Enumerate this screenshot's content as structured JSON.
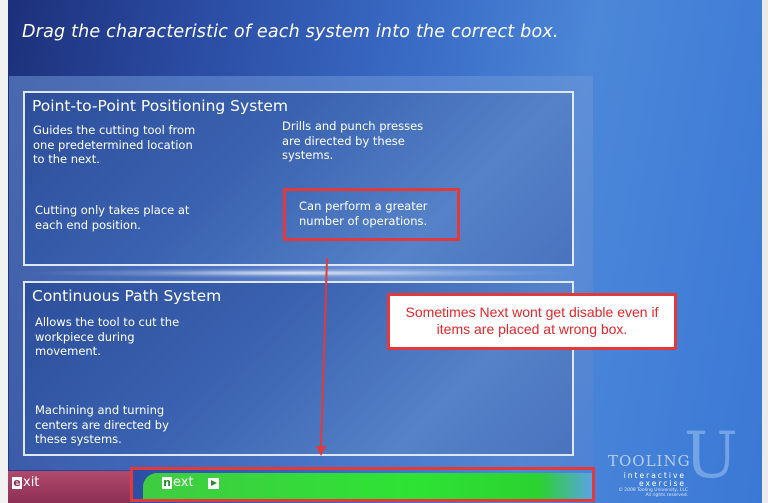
{
  "header": {
    "title": "Drag the characteristic of each system into the correct box."
  },
  "boxes": [
    {
      "title": "Point-to-Point Positioning System",
      "items": [
        "Guides the cutting tool from one predetermined location to the next.",
        "Cutting only takes place at each end position.",
        "Drills and punch presses are directed by these systems.",
        "Can perform a greater number of operations."
      ]
    },
    {
      "title": "Continuous Path System",
      "items": [
        "Allows the tool to cut the workpiece during movement.",
        "Machining and turning centers are directed by these systems."
      ]
    }
  ],
  "callout": {
    "text": "Sometimes Next wont get disable even if items are placed at wrong box."
  },
  "footer": {
    "exit_cap": "e",
    "exit_rest": "xit",
    "next_cap": "n",
    "next_rest": "ext"
  },
  "logo": {
    "tooling": "TOOLING",
    "u": "U",
    "line1": "interactive",
    "line2": "exercise",
    "copyright": "© 2008 Tooling University, LLC All rights reserved."
  },
  "colors": {
    "highlight": "#e23a3a",
    "next_green": "#2ee334",
    "exit_maroon": "#8d2f55"
  }
}
